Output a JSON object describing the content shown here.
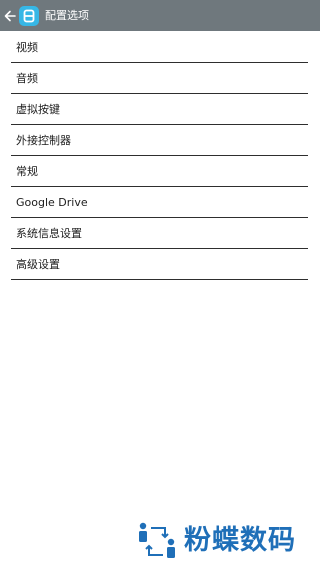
{
  "actionbar": {
    "title": "配置选项",
    "background": "#6f787d",
    "icon_color": "#36b7e6"
  },
  "menu": {
    "items": [
      {
        "label": "视频"
      },
      {
        "label": "音频"
      },
      {
        "label": "虚拟按键"
      },
      {
        "label": "外接控制器"
      },
      {
        "label": "常规"
      },
      {
        "label": "Google Drive"
      },
      {
        "label": "系统信息设置"
      },
      {
        "label": "高级设置"
      }
    ]
  },
  "watermark": {
    "text": "粉蝶数码",
    "color": "#1f6fb8"
  },
  "icons": [
    "back-arrow-icon",
    "app-logo-icon",
    "watermark-logo-icon"
  ]
}
